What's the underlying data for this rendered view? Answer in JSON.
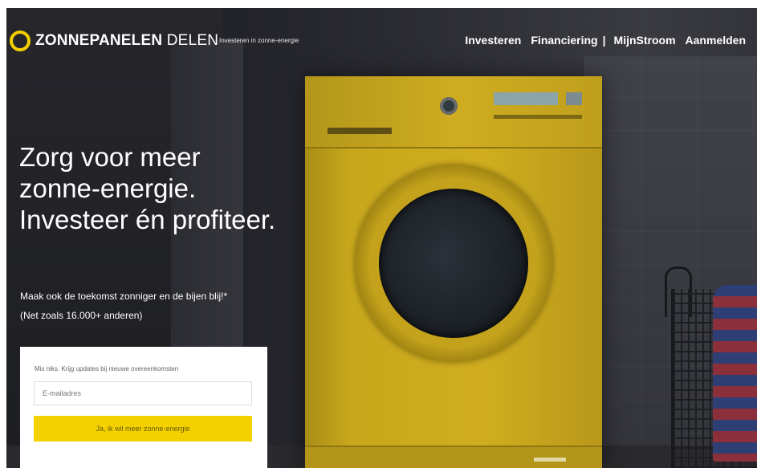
{
  "brand": {
    "name_bold": "ZONNEPANELEN",
    "name_light": "DELEN",
    "tagline": "Investeren in zonne-energie"
  },
  "nav": {
    "items": [
      "Investeren",
      "Financiering",
      "MijnStroom",
      "Aanmelden"
    ],
    "separator": "|"
  },
  "hero": {
    "headline": "Zorg voor meer zonne-energie. Investeer én profiteer.",
    "subline": "Maak ook de toekomst zonniger en de bijen blij!*",
    "subline2": "(Net zoals 16.000+ anderen)"
  },
  "signup": {
    "label": "Mis niks. Krijg updates bij nieuwe overeenkomsten",
    "email_placeholder": "E-mailadres",
    "button_label": "Ja, ik wil meer zonne-energie"
  },
  "colors": {
    "accent": "#f3d100",
    "washer": "#cfac20"
  }
}
